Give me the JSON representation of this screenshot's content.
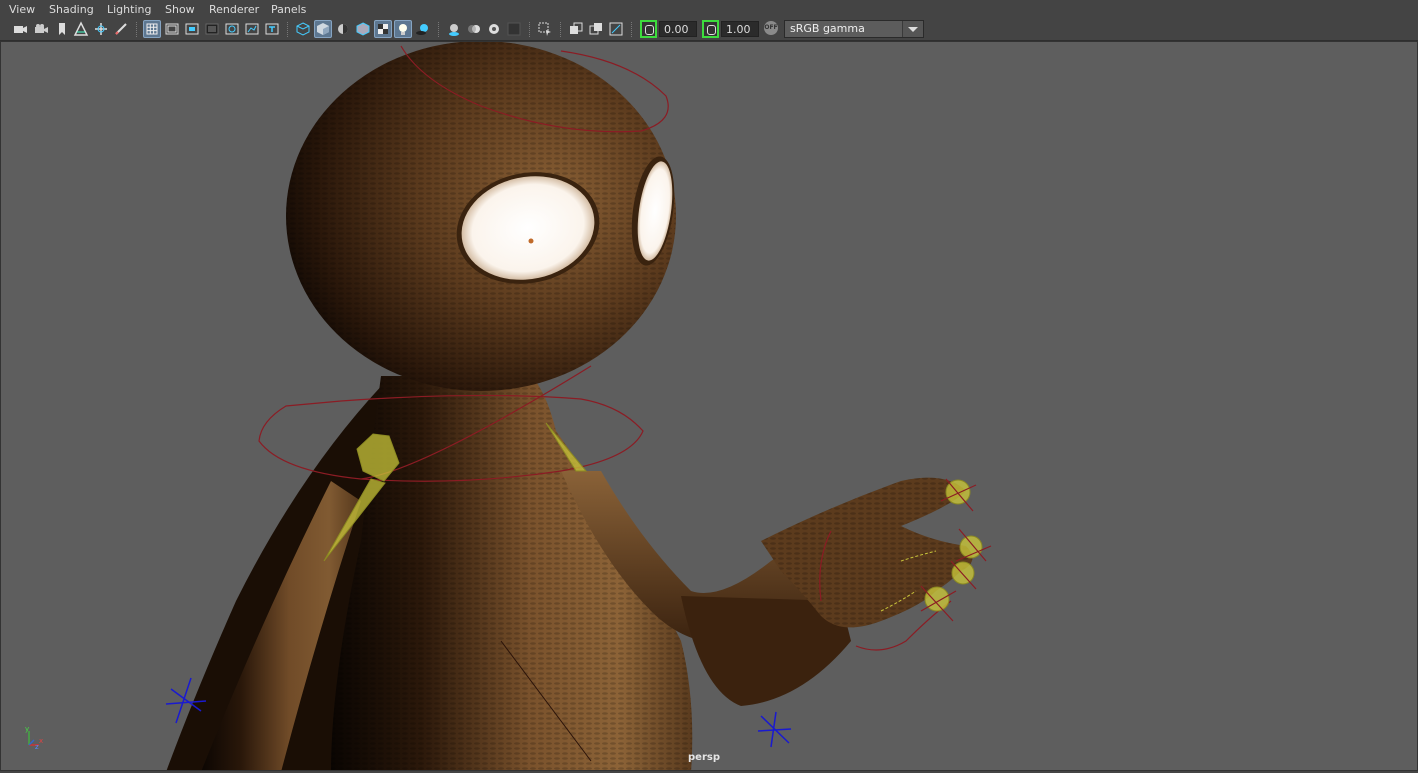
{
  "menu": {
    "view": "View",
    "shading": "Shading",
    "lighting": "Lighting",
    "show": "Show",
    "renderer": "Renderer",
    "panels": "Panels"
  },
  "toolbar": {
    "exposure_value": "0.00",
    "gamma_value": "1.00",
    "color_space": "sRGB gamma",
    "color_management_badge": "OFF"
  },
  "viewport": {
    "camera_label": "persp",
    "axis_x": "x",
    "axis_y": "y",
    "axis_z": "z"
  },
  "colors": {
    "viewport_bg": "#5e5e5e",
    "toolbar_bg": "#444444",
    "active_button": "#5d7791",
    "highlight_green": "#3ddc3d",
    "rig_curve": "#8b1c24",
    "joint_yellow": "#c8c43a",
    "light_locator": "#1a1ad0"
  }
}
